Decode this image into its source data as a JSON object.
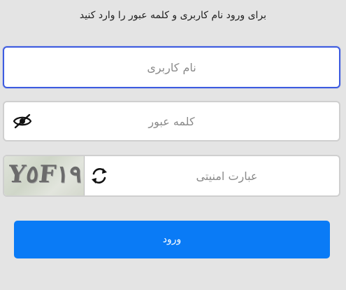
{
  "instruction": "برای ورود نام کاربری و کلمه عبور را وارد کنید",
  "username": {
    "placeholder": "نام کاربری",
    "value": ""
  },
  "password": {
    "placeholder": "کلمه عبور",
    "value": "",
    "toggle_icon": "eye-slash-icon"
  },
  "captcha": {
    "placeholder": "عبارت امنیتی",
    "value": "",
    "image_text": "Y٥F١٩",
    "refresh_icon": "refresh-icon"
  },
  "login_button": {
    "label": "ورود"
  },
  "colors": {
    "background": "#e4e4e4",
    "focus_border": "#3d5be0",
    "button": "#0a7bf6"
  }
}
